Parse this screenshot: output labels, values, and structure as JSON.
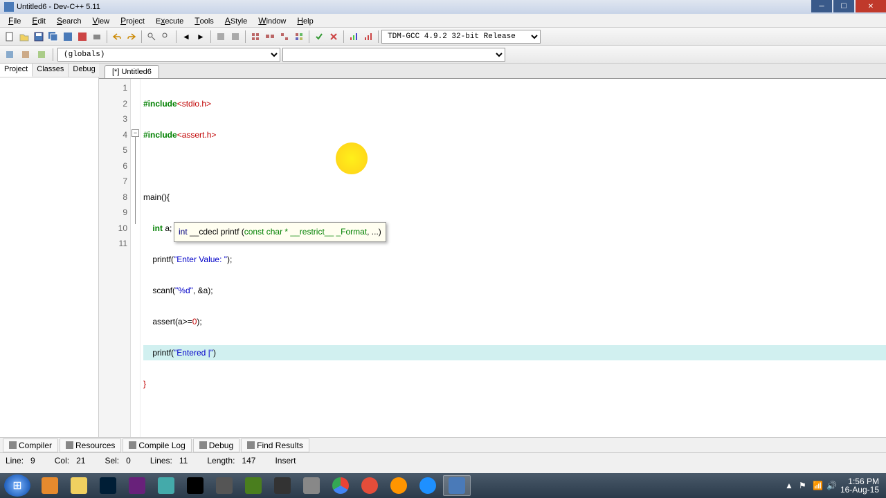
{
  "window": {
    "title": "Untitled6 - Dev-C++ 5.11"
  },
  "menu": {
    "file": "File",
    "edit": "Edit",
    "search": "Search",
    "view": "View",
    "project": "Project",
    "execute": "Execute",
    "tools": "Tools",
    "astyle": "AStyle",
    "window": "Window",
    "help": "Help"
  },
  "toolbar": {
    "compiler_combo": "TDM-GCC 4.9.2 32-bit Release",
    "globals": "(globals)"
  },
  "side_tabs": {
    "project": "Project",
    "classes": "Classes",
    "debug": "Debug"
  },
  "editor": {
    "tab": "[*] Untitled6",
    "lines": [
      "1",
      "2",
      "3",
      "4",
      "5",
      "6",
      "7",
      "8",
      "9",
      "10",
      "11"
    ],
    "code": {
      "l1_pre": "#include",
      "l1_hdr": "<stdio.h>",
      "l2_pre": "#include",
      "l2_hdr": "<assert.h>",
      "l4_fn": "main",
      "l4_rest": "(){",
      "l5_kw": "int",
      "l5_rest": " a;",
      "l6_fn": "printf",
      "l6_open": "(",
      "l6_str": "\"Enter Value: \"",
      "l6_close": ");",
      "l7_fn": "scanf",
      "l7_open": "(",
      "l7_str": "\"%d\"",
      "l7_mid": ", &a);",
      "l8_fn": "assert",
      "l8_rest": "(a>=",
      "l8_num": "0",
      "l8_end": ");",
      "l9_fn": "printf",
      "l9_open": "(",
      "l9_str": "\"Entered |\"",
      "l9_close": ")",
      "l10": "}"
    },
    "tooltip": {
      "full": "int __cdecl printf (const char * __restrict__ _Format, ...)",
      "p1": "int ",
      "p2": "__cdecl ",
      "p3": "printf ",
      "p4": "(",
      "p5": "const char * __restrict__ _Format",
      "p6": ", ...)"
    }
  },
  "bottom_tabs": {
    "compiler": "Compiler",
    "resources": "Resources",
    "compile_log": "Compile Log",
    "debug": "Debug",
    "find_results": "Find Results"
  },
  "status": {
    "line_lbl": "Line:",
    "line_val": "9",
    "col_lbl": "Col:",
    "col_val": "21",
    "sel_lbl": "Sel:",
    "sel_val": "0",
    "lines_lbl": "Lines:",
    "lines_val": "11",
    "length_lbl": "Length:",
    "length_val": "147",
    "mode": "Insert"
  },
  "tray": {
    "time": "1:56 PM",
    "date": "16-Aug-15"
  },
  "colors": {
    "ps": "#001e36",
    "vs": "#68217a",
    "cmd": "#000",
    "dw": "#4a7e1e",
    "chrome": "#f2c14e",
    "opera": "#e44d3a",
    "ff": "#ff9500",
    "ie": "#1e90ff",
    "dev": "#4a7ab8"
  }
}
